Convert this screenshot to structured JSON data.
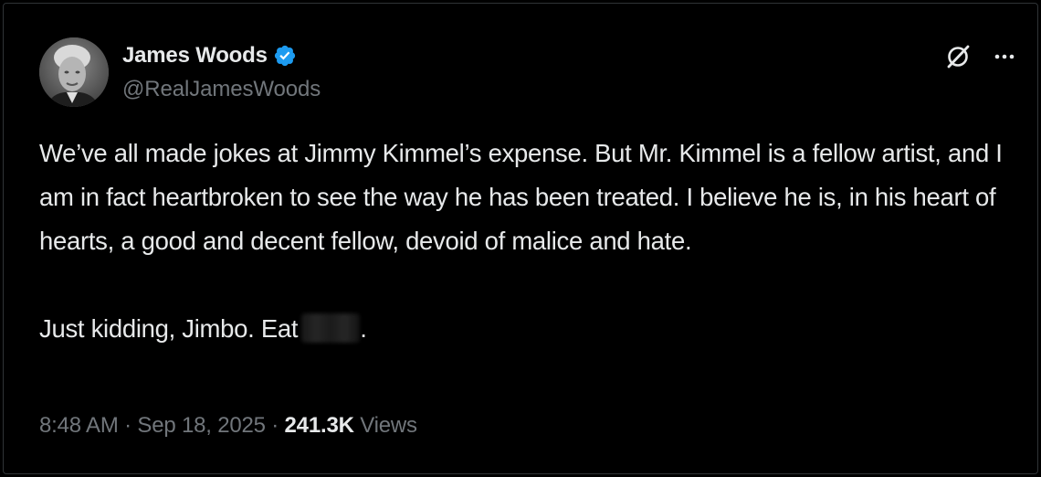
{
  "author": {
    "display_name": "James Woods",
    "handle": "@RealJamesWoods",
    "verified": true
  },
  "tweet": {
    "paragraph1": "We’ve all made jokes at Jimmy Kimmel’s expense. But Mr. Kimmel is a fellow artist, and I am in fact heartbroken to see the way he has been treated. I believe he is, in his heart of hearts, a good and decent fellow, devoid of malice and hate.",
    "paragraph2": "Just kidding, Jimbo. Eat",
    "paragraph2_end": "."
  },
  "meta": {
    "time": "8:48 AM",
    "separator": "·",
    "date": "Sep 18, 2025",
    "views_count": "241.3K",
    "views_label": "Views"
  },
  "icons": {
    "grok": "grok-icon",
    "more": "more-icon",
    "verified": "verified-badge-icon"
  },
  "colors": {
    "background": "#000000",
    "text_primary": "#e7e9ea",
    "text_secondary": "#71767b",
    "verified_blue": "#1d9bf0"
  }
}
